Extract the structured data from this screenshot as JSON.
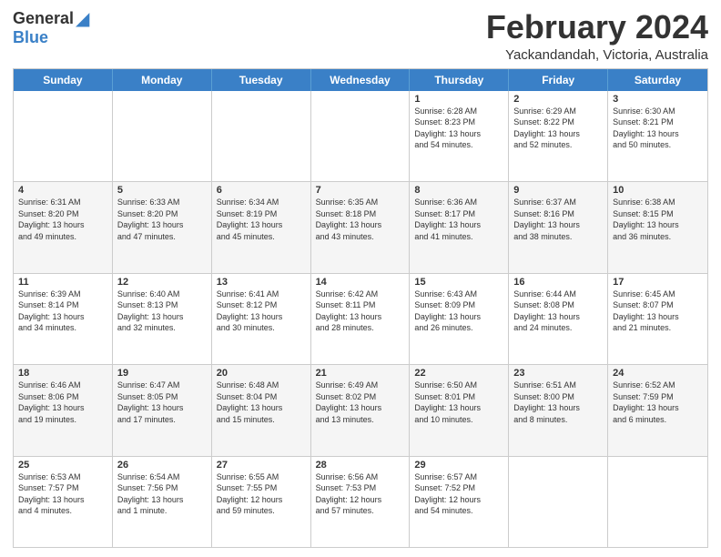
{
  "header": {
    "logo_general": "General",
    "logo_blue": "Blue",
    "title": "February 2024",
    "location": "Yackandandah, Victoria, Australia"
  },
  "weekdays": [
    "Sunday",
    "Monday",
    "Tuesday",
    "Wednesday",
    "Thursday",
    "Friday",
    "Saturday"
  ],
  "rows": [
    [
      {
        "day": "",
        "info": ""
      },
      {
        "day": "",
        "info": ""
      },
      {
        "day": "",
        "info": ""
      },
      {
        "day": "",
        "info": ""
      },
      {
        "day": "1",
        "info": "Sunrise: 6:28 AM\nSunset: 8:23 PM\nDaylight: 13 hours\nand 54 minutes."
      },
      {
        "day": "2",
        "info": "Sunrise: 6:29 AM\nSunset: 8:22 PM\nDaylight: 13 hours\nand 52 minutes."
      },
      {
        "day": "3",
        "info": "Sunrise: 6:30 AM\nSunset: 8:21 PM\nDaylight: 13 hours\nand 50 minutes."
      }
    ],
    [
      {
        "day": "4",
        "info": "Sunrise: 6:31 AM\nSunset: 8:20 PM\nDaylight: 13 hours\nand 49 minutes."
      },
      {
        "day": "5",
        "info": "Sunrise: 6:33 AM\nSunset: 8:20 PM\nDaylight: 13 hours\nand 47 minutes."
      },
      {
        "day": "6",
        "info": "Sunrise: 6:34 AM\nSunset: 8:19 PM\nDaylight: 13 hours\nand 45 minutes."
      },
      {
        "day": "7",
        "info": "Sunrise: 6:35 AM\nSunset: 8:18 PM\nDaylight: 13 hours\nand 43 minutes."
      },
      {
        "day": "8",
        "info": "Sunrise: 6:36 AM\nSunset: 8:17 PM\nDaylight: 13 hours\nand 41 minutes."
      },
      {
        "day": "9",
        "info": "Sunrise: 6:37 AM\nSunset: 8:16 PM\nDaylight: 13 hours\nand 38 minutes."
      },
      {
        "day": "10",
        "info": "Sunrise: 6:38 AM\nSunset: 8:15 PM\nDaylight: 13 hours\nand 36 minutes."
      }
    ],
    [
      {
        "day": "11",
        "info": "Sunrise: 6:39 AM\nSunset: 8:14 PM\nDaylight: 13 hours\nand 34 minutes."
      },
      {
        "day": "12",
        "info": "Sunrise: 6:40 AM\nSunset: 8:13 PM\nDaylight: 13 hours\nand 32 minutes."
      },
      {
        "day": "13",
        "info": "Sunrise: 6:41 AM\nSunset: 8:12 PM\nDaylight: 13 hours\nand 30 minutes."
      },
      {
        "day": "14",
        "info": "Sunrise: 6:42 AM\nSunset: 8:11 PM\nDaylight: 13 hours\nand 28 minutes."
      },
      {
        "day": "15",
        "info": "Sunrise: 6:43 AM\nSunset: 8:09 PM\nDaylight: 13 hours\nand 26 minutes."
      },
      {
        "day": "16",
        "info": "Sunrise: 6:44 AM\nSunset: 8:08 PM\nDaylight: 13 hours\nand 24 minutes."
      },
      {
        "day": "17",
        "info": "Sunrise: 6:45 AM\nSunset: 8:07 PM\nDaylight: 13 hours\nand 21 minutes."
      }
    ],
    [
      {
        "day": "18",
        "info": "Sunrise: 6:46 AM\nSunset: 8:06 PM\nDaylight: 13 hours\nand 19 minutes."
      },
      {
        "day": "19",
        "info": "Sunrise: 6:47 AM\nSunset: 8:05 PM\nDaylight: 13 hours\nand 17 minutes."
      },
      {
        "day": "20",
        "info": "Sunrise: 6:48 AM\nSunset: 8:04 PM\nDaylight: 13 hours\nand 15 minutes."
      },
      {
        "day": "21",
        "info": "Sunrise: 6:49 AM\nSunset: 8:02 PM\nDaylight: 13 hours\nand 13 minutes."
      },
      {
        "day": "22",
        "info": "Sunrise: 6:50 AM\nSunset: 8:01 PM\nDaylight: 13 hours\nand 10 minutes."
      },
      {
        "day": "23",
        "info": "Sunrise: 6:51 AM\nSunset: 8:00 PM\nDaylight: 13 hours\nand 8 minutes."
      },
      {
        "day": "24",
        "info": "Sunrise: 6:52 AM\nSunset: 7:59 PM\nDaylight: 13 hours\nand 6 minutes."
      }
    ],
    [
      {
        "day": "25",
        "info": "Sunrise: 6:53 AM\nSunset: 7:57 PM\nDaylight: 13 hours\nand 4 minutes."
      },
      {
        "day": "26",
        "info": "Sunrise: 6:54 AM\nSunset: 7:56 PM\nDaylight: 13 hours\nand 1 minute."
      },
      {
        "day": "27",
        "info": "Sunrise: 6:55 AM\nSunset: 7:55 PM\nDaylight: 12 hours\nand 59 minutes."
      },
      {
        "day": "28",
        "info": "Sunrise: 6:56 AM\nSunset: 7:53 PM\nDaylight: 12 hours\nand 57 minutes."
      },
      {
        "day": "29",
        "info": "Sunrise: 6:57 AM\nSunset: 7:52 PM\nDaylight: 12 hours\nand 54 minutes."
      },
      {
        "day": "",
        "info": ""
      },
      {
        "day": "",
        "info": ""
      }
    ]
  ]
}
